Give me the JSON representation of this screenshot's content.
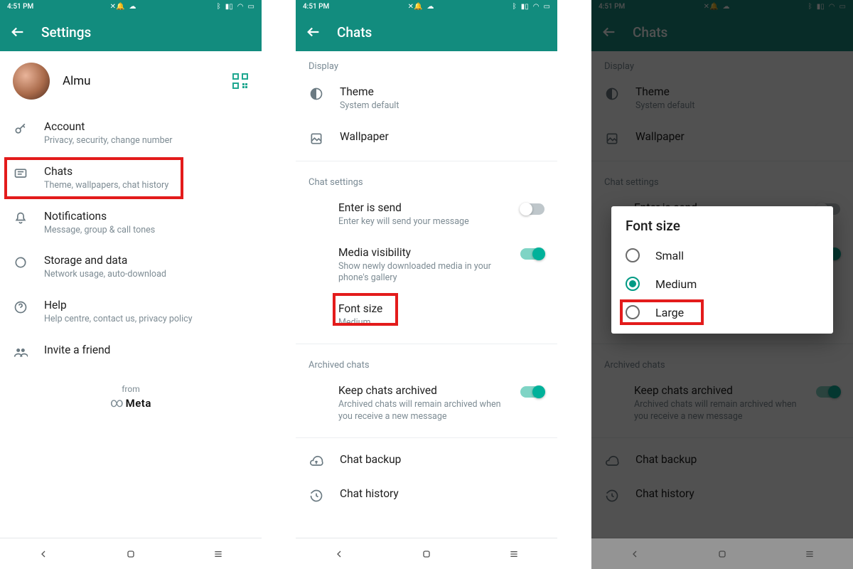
{
  "status": {
    "time": "4:51 PM"
  },
  "panel1": {
    "title": "Settings",
    "username": "Almu",
    "items": [
      {
        "icon": "key",
        "title": "Account",
        "sub": "Privacy, security, change number"
      },
      {
        "icon": "chats",
        "title": "Chats",
        "sub": "Theme, wallpapers, chat history"
      },
      {
        "icon": "bell",
        "title": "Notifications",
        "sub": "Message, group & call tones"
      },
      {
        "icon": "data",
        "title": "Storage and data",
        "sub": "Network usage, auto-download"
      },
      {
        "icon": "help",
        "title": "Help",
        "sub": "Help centre, contact us, privacy policy"
      },
      {
        "icon": "people",
        "title": "Invite a friend",
        "sub": ""
      }
    ],
    "from": "from",
    "meta": "Meta"
  },
  "panel2": {
    "title": "Chats",
    "section_display": "Display",
    "theme": {
      "title": "Theme",
      "sub": "System default"
    },
    "wallpaper": {
      "title": "Wallpaper"
    },
    "section_chat": "Chat settings",
    "enter": {
      "title": "Enter is send",
      "sub": "Enter key will send your message"
    },
    "media": {
      "title": "Media visibility",
      "sub": "Show newly downloaded media in your phone's gallery"
    },
    "font": {
      "title": "Font size",
      "sub": "Medium"
    },
    "section_arch": "Archived chats",
    "keep": {
      "title": "Keep chats archived",
      "sub": "Archived chats will remain archived when you receive a new message"
    },
    "backup": {
      "title": "Chat backup"
    },
    "history": {
      "title": "Chat history"
    }
  },
  "dialog": {
    "title": "Font size",
    "options": [
      {
        "label": "Small",
        "checked": false
      },
      {
        "label": "Medium",
        "checked": true
      },
      {
        "label": "Large",
        "checked": false
      }
    ]
  }
}
